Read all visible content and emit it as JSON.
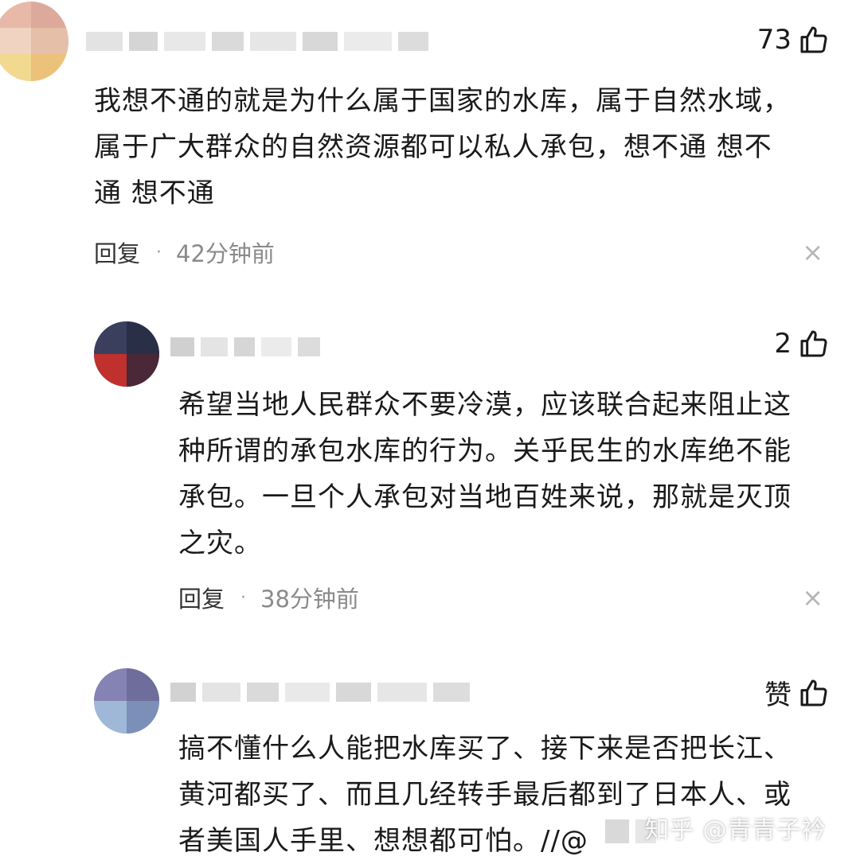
{
  "comments": [
    {
      "likes": "73",
      "text": "我想不通的就是为什么属于国家的水库，属于自然水域，\n属于广大群众的自然资源都可以私人承包，想不通 想不\n通 想不通",
      "reply_label": "回复",
      "dot": "·",
      "time": "42分钟前",
      "close": "×"
    },
    {
      "likes": "2",
      "text": "希望当地人民群众不要冷漠，应该联合起来阻止这\n种所谓的承包水库的行为。关乎民生的水库绝不能\n承包。一旦个人承包对当地百姓来说，那就是灭顶\n之灾。",
      "reply_label": "回复",
      "dot": "·",
      "time": "38分钟前",
      "close": "×"
    },
    {
      "likes": "赞",
      "text": "搞不懂什么人能把水库买了、接下来是否把长江、\n黄河都买了、而且几经转手最后都到了日本人、或\n者美国人手里、想想都可怕。//@",
      "reply_label": "",
      "dot": "",
      "time": "",
      "close": ""
    }
  ],
  "watermark": "知乎 @青青子衿",
  "colors": {
    "text": "#1a1a1a",
    "meta": "#8a8a8a",
    "close": "#b5b5b5",
    "background": "#ffffff"
  },
  "icons": {
    "like": "thumbs-up-icon",
    "close": "close-icon"
  }
}
